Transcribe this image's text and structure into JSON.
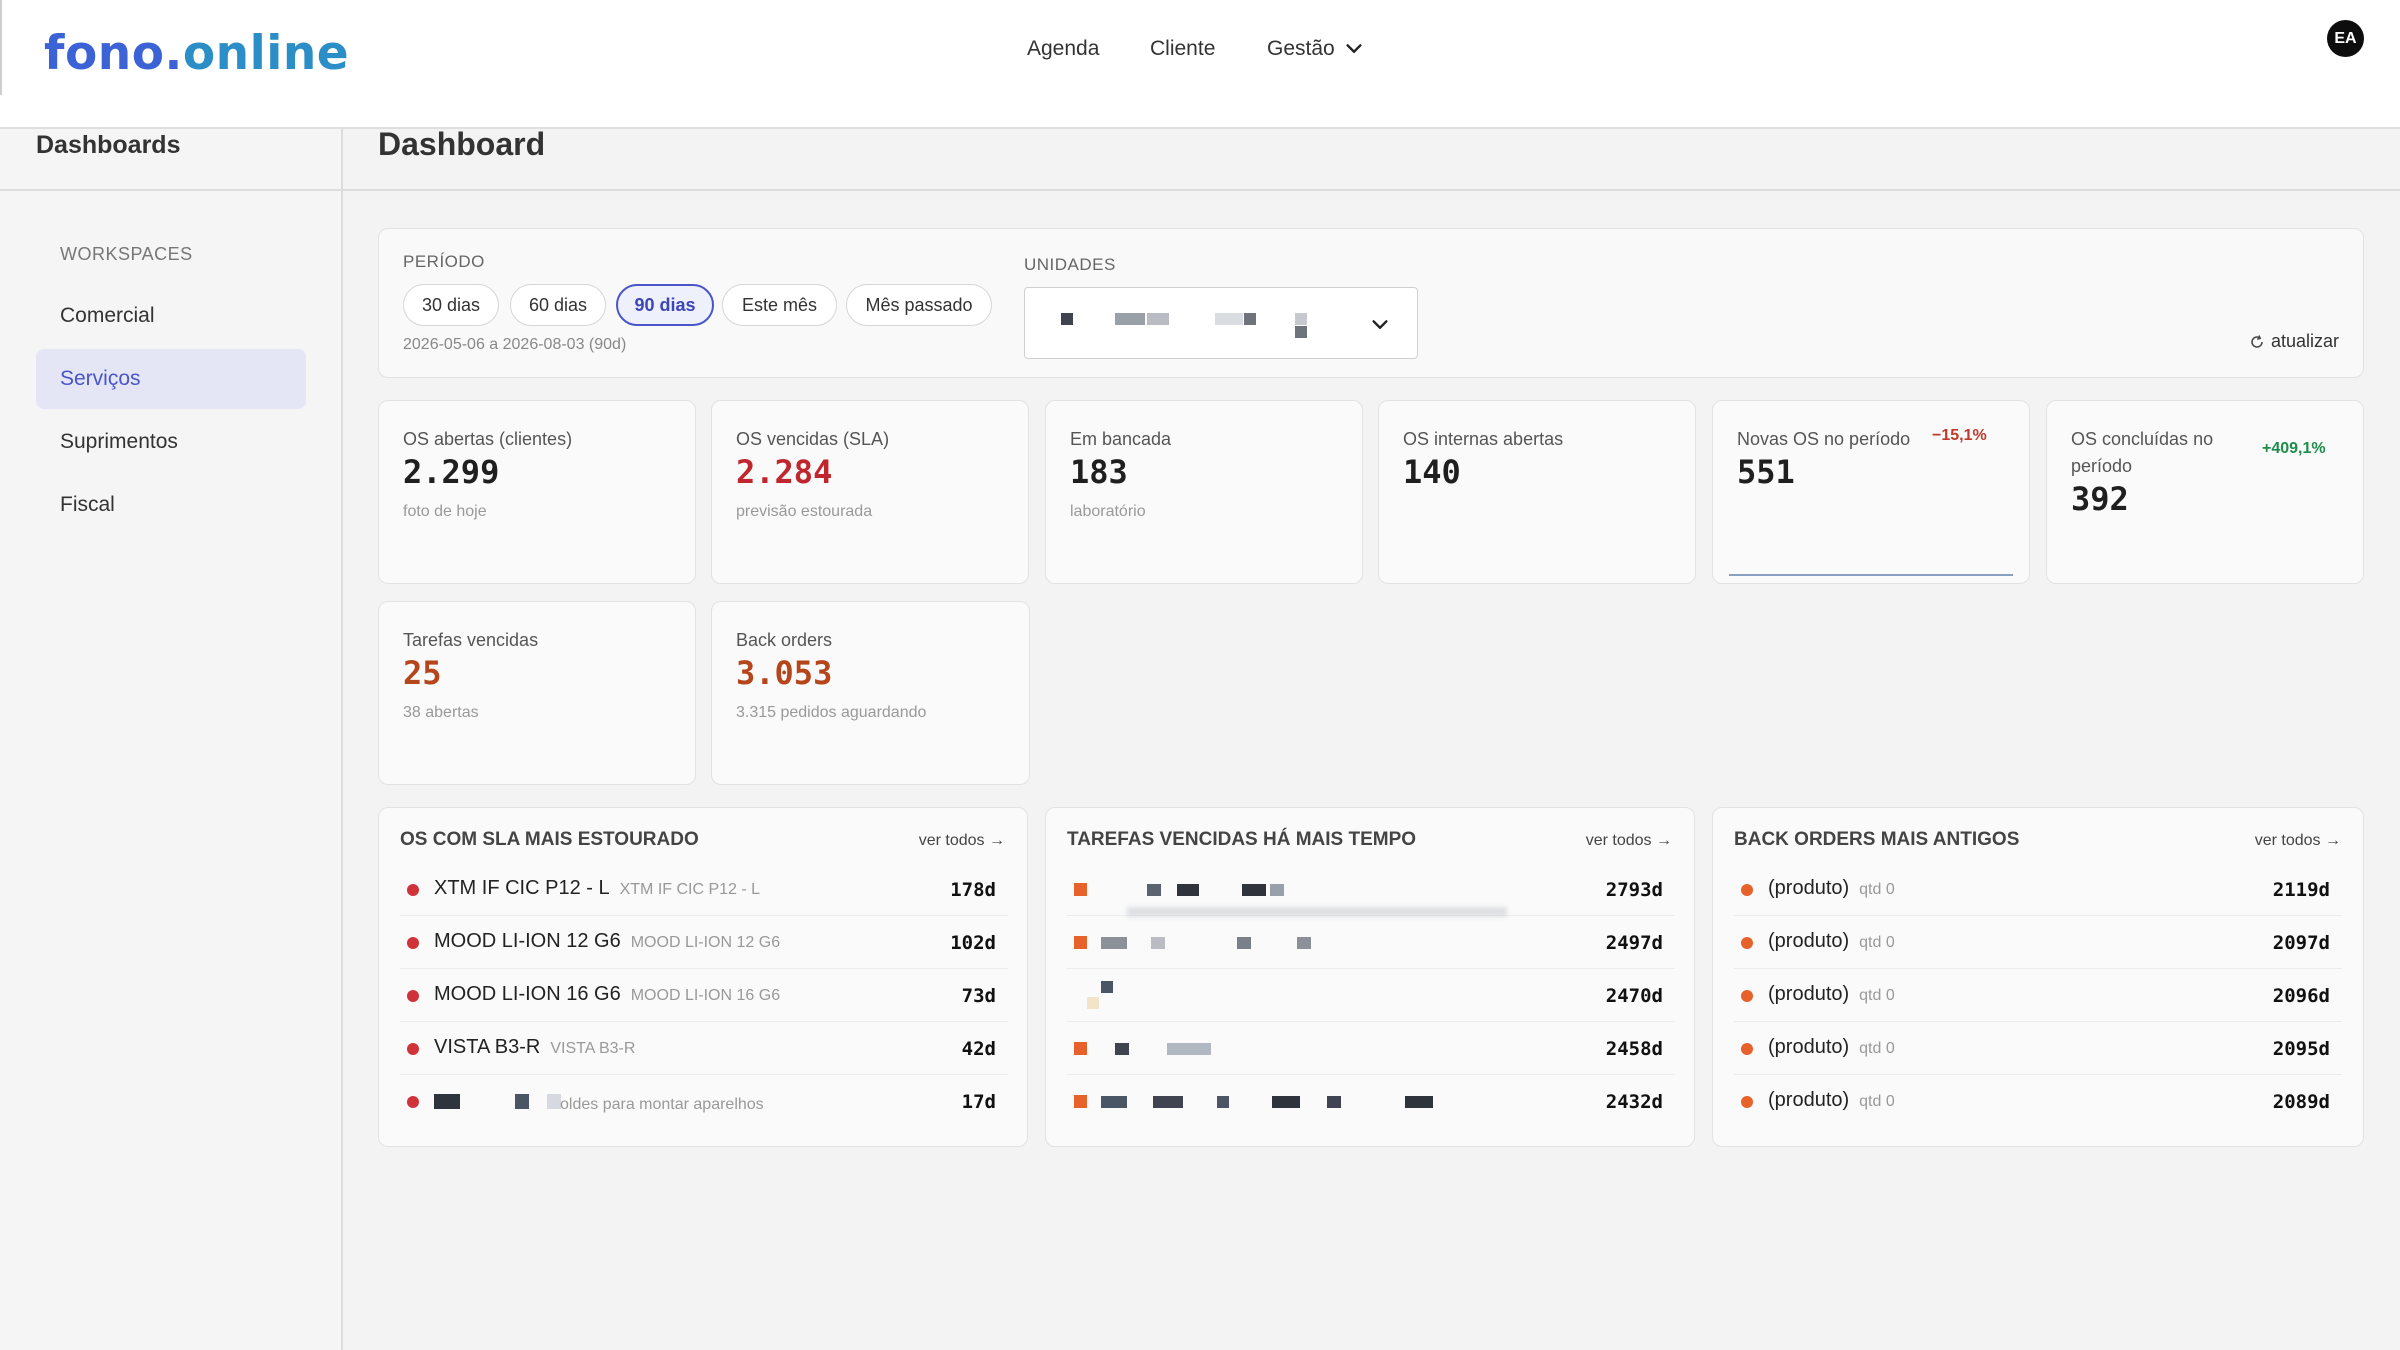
{
  "header": {
    "logo_part1": "fono.",
    "logo_part2": "online",
    "nav": [
      "Agenda",
      "Cliente",
      "Gestão"
    ],
    "avatar": "EA"
  },
  "sidebar": {
    "title": "Dashboards",
    "section": "WORKSPACES",
    "items": [
      {
        "label": "Comercial",
        "active": false
      },
      {
        "label": "Serviços",
        "active": true
      },
      {
        "label": "Suprimentos",
        "active": false
      },
      {
        "label": "Fiscal",
        "active": false
      }
    ]
  },
  "page": {
    "title": "Dashboard"
  },
  "filters": {
    "period_label": "PERÍODO",
    "chips": [
      "30 dias",
      "60 dias",
      "90 dias",
      "Este mês",
      "Mês passado"
    ],
    "active_chip": "90 dias",
    "range": "2026-05-06 a 2026-08-03 (90d)",
    "units_label": "UNIDADES",
    "refresh": "atualizar"
  },
  "kpis": [
    {
      "label": "OS abertas (clientes)",
      "value": "2.299",
      "sub": "foto de hoje",
      "color": "#1f1f1f"
    },
    {
      "label": "OS vencidas (SLA)",
      "value": "2.284",
      "sub": "previsão estourada",
      "color": "#c0262d"
    },
    {
      "label": "Em bancada",
      "value": "183",
      "sub": "laboratório",
      "color": "#1f1f1f"
    },
    {
      "label": "OS internas abertas",
      "value": "140",
      "sub": "",
      "color": "#1f1f1f"
    },
    {
      "label": "Novas OS no período",
      "value": "551",
      "sub": "",
      "color": "#1f1f1f",
      "badge": "−15,1%",
      "badge_color": "#c0392b"
    },
    {
      "label": "OS concluídas no período",
      "value": "392",
      "sub": "",
      "color": "#1f1f1f",
      "badge": "+409,1%",
      "badge_color": "#1e8c4a"
    },
    {
      "label": "Tarefas vencidas",
      "value": "25",
      "sub": "38 abertas",
      "color": "#b5461b"
    },
    {
      "label": "Back orders",
      "value": "3.053",
      "sub": "3.315 pedidos aguardando",
      "color": "#b5461b"
    }
  ],
  "panels": {
    "sla": {
      "title": "OS COM SLA MAIS ESTOURADO",
      "link": "ver todos →",
      "rows": [
        {
          "name": "XTM IF CIC P12 - L",
          "meta": "XTM IF CIC P12 - L",
          "days": "178d"
        },
        {
          "name": "MOOD LI-ION 12 G6",
          "meta": "MOOD LI-ION 12 G6",
          "days": "102d"
        },
        {
          "name": "MOOD LI-ION 16 G6",
          "meta": "MOOD LI-ION 16 G6",
          "days": "73d"
        },
        {
          "name": "VISTA B3-R",
          "meta": "VISTA B3-R",
          "days": "42d"
        },
        {
          "name": "",
          "meta": "oldes para montar aparelhos",
          "days": "17d"
        }
      ],
      "dot_color": "#d0323a"
    },
    "tasks": {
      "title": "TAREFAS VENCIDAS HÁ MAIS TEMPO",
      "link": "ver todos →",
      "rows": [
        {
          "days": "2793d"
        },
        {
          "days": "2497d"
        },
        {
          "days": "2470d"
        },
        {
          "days": "2458d"
        },
        {
          "days": "2432d"
        }
      ]
    },
    "backorders": {
      "title": "BACK ORDERS MAIS ANTIGOS",
      "link": "ver todos →",
      "rows": [
        {
          "name": "(produto)",
          "meta": "qtd 0",
          "days": "2119d"
        },
        {
          "name": "(produto)",
          "meta": "qtd 0",
          "days": "2097d"
        },
        {
          "name": "(produto)",
          "meta": "qtd 0",
          "days": "2096d"
        },
        {
          "name": "(produto)",
          "meta": "qtd 0",
          "days": "2095d"
        },
        {
          "name": "(produto)",
          "meta": "qtd 0",
          "days": "2089d"
        }
      ],
      "dot_color": "#e6622a"
    }
  }
}
